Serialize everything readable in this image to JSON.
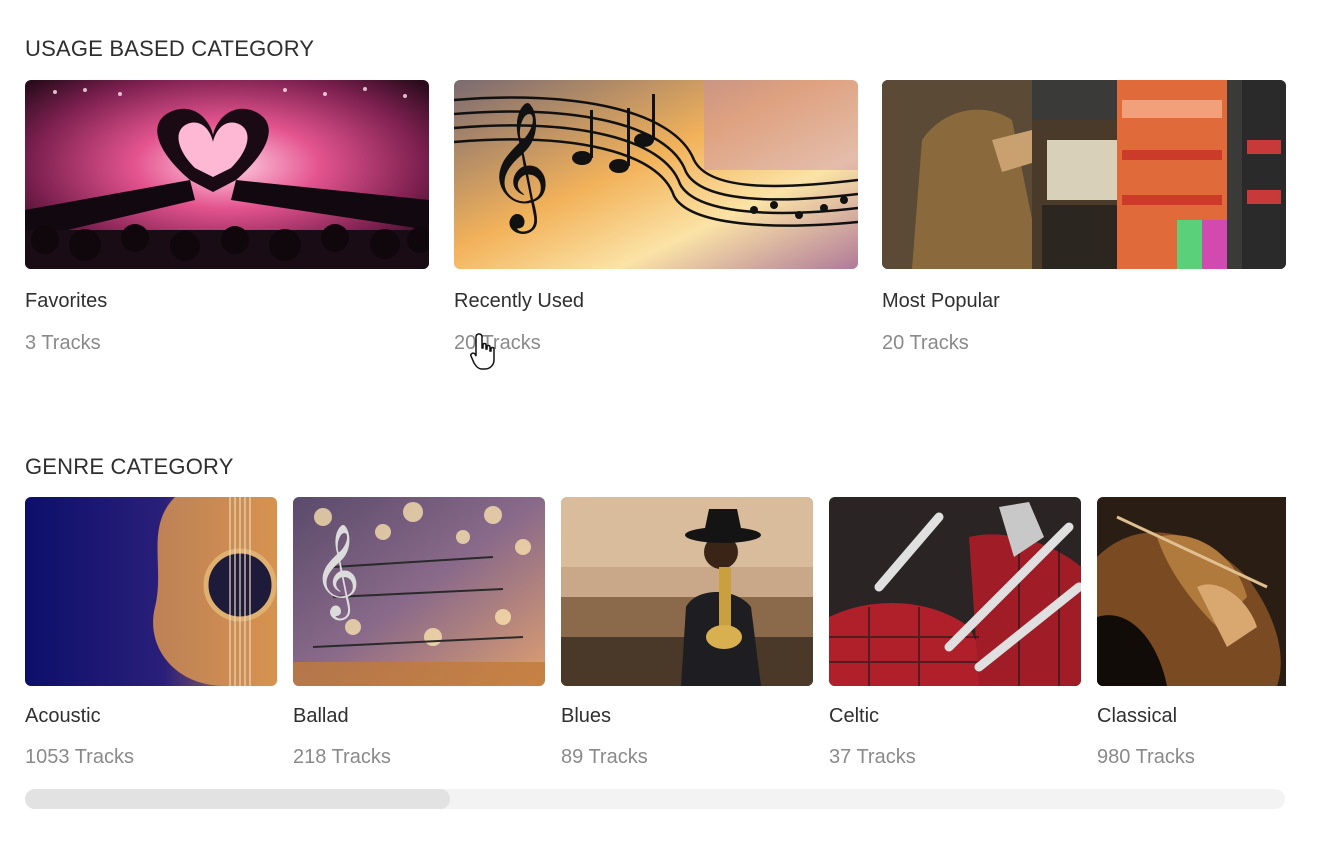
{
  "usage_section": {
    "title": "USAGE BASED CATEGORY",
    "cards": [
      {
        "name": "Favorites",
        "tracks": "3 Tracks",
        "image": "concert-heart-hands-image"
      },
      {
        "name": "Recently Used",
        "tracks": "20 Tracks",
        "image": "music-notes-staff-image"
      },
      {
        "name": "Most Popular",
        "tracks": "20 Tracks",
        "image": "jukebox-image"
      }
    ]
  },
  "genre_section": {
    "title": "GENRE CATEGORY",
    "cards": [
      {
        "name": "Acoustic",
        "tracks": "1053 Tracks",
        "image": "acoustic-guitar-image"
      },
      {
        "name": "Ballad",
        "tracks": "218 Tracks",
        "image": "ballad-notes-bokeh-image"
      },
      {
        "name": "Blues",
        "tracks": "89 Tracks",
        "image": "trumpet-player-image"
      },
      {
        "name": "Celtic",
        "tracks": "37 Tracks",
        "image": "bagpipes-image"
      },
      {
        "name": "Classical",
        "tracks": "980 Tracks",
        "image": "violin-image"
      }
    ],
    "scroll_position": 0.0
  },
  "cursor": "hand-pointer-icon"
}
